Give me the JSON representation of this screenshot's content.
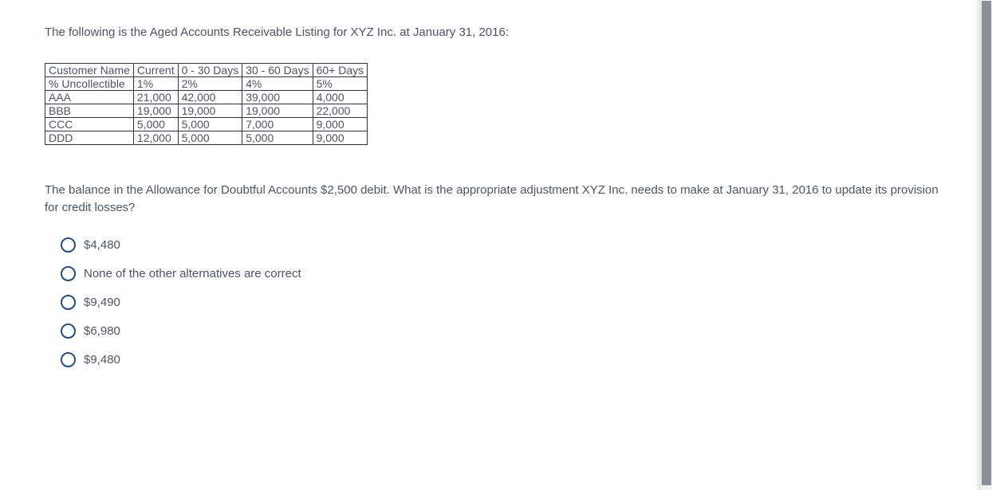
{
  "intro": "The following is the Aged Accounts Receivable Listing for XYZ Inc. at January 31, 2016:",
  "table": {
    "header": [
      "Customer Name",
      "Current",
      "0 - 30 Days",
      "30 - 60 Days",
      "60+ Days"
    ],
    "rows": [
      [
        "% Uncollectible",
        "1%",
        "2%",
        "4%",
        "5%"
      ],
      [
        "AAA",
        "21,000",
        "42,000",
        "39,000",
        "4,000"
      ],
      [
        "BBB",
        "19,000",
        "19,000",
        "19,000",
        "22,000"
      ],
      [
        "CCC",
        "5,000",
        "5,000",
        "7,000",
        "9,000"
      ],
      [
        "DDD",
        "12,000",
        "5,000",
        "5,000",
        "9,000"
      ]
    ]
  },
  "question": "The balance in the Allowance for Doubtful Accounts $2,500 debit. What is the appropriate adjustment XYZ Inc. needs to make at January 31, 2016 to update its provision for credit losses?",
  "options": [
    "$4,480",
    "None of the other alternatives are correct",
    "$9,490",
    "$6,980",
    "$9,480"
  ]
}
